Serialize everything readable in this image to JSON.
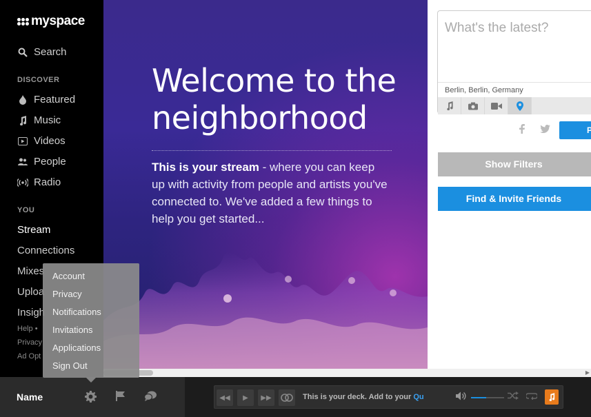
{
  "brand": {
    "name": "myspace"
  },
  "sidebar": {
    "search": "Search",
    "discover_label": "DISCOVER",
    "discover": [
      {
        "label": "Featured",
        "icon": "flame-icon"
      },
      {
        "label": "Music",
        "icon": "music-note-icon"
      },
      {
        "label": "Videos",
        "icon": "video-icon"
      },
      {
        "label": "People",
        "icon": "people-icon"
      },
      {
        "label": "Radio",
        "icon": "radio-icon"
      }
    ],
    "you_label": "YOU",
    "you": [
      "Stream",
      "Connections",
      "Mixes",
      "Uploa",
      "Insigh"
    ],
    "footer_links": [
      "Help",
      "•",
      "Privacy",
      "Ad Opt"
    ]
  },
  "hero": {
    "title": "Welcome to the neighborhood",
    "lead_bold": "This is your stream",
    "lead_rest": " - where you can keep up with activity from people and artists you've connected to. We've added a few things to help you get started..."
  },
  "compose": {
    "placeholder": "What's the latest?",
    "location": "Berlin, Berlin, Germany",
    "tools": [
      "music-icon",
      "camera-icon",
      "video-camera-icon",
      "location-pin-icon"
    ],
    "post_label": "P"
  },
  "buttons": {
    "show_filters": "Show Filters",
    "find_invite": "Find & Invite Friends"
  },
  "user_menu": {
    "items": [
      "Account",
      "Privacy",
      "Notifications",
      "Invitations",
      "Applications",
      "Sign Out"
    ]
  },
  "bottombar": {
    "username": "Name",
    "deck_text": "This is your deck. Add to your ",
    "deck_link": "Qu",
    "volume": 0.45
  },
  "colors": {
    "accent": "#1b8fe0",
    "deck_orange": "#e87b1c"
  }
}
